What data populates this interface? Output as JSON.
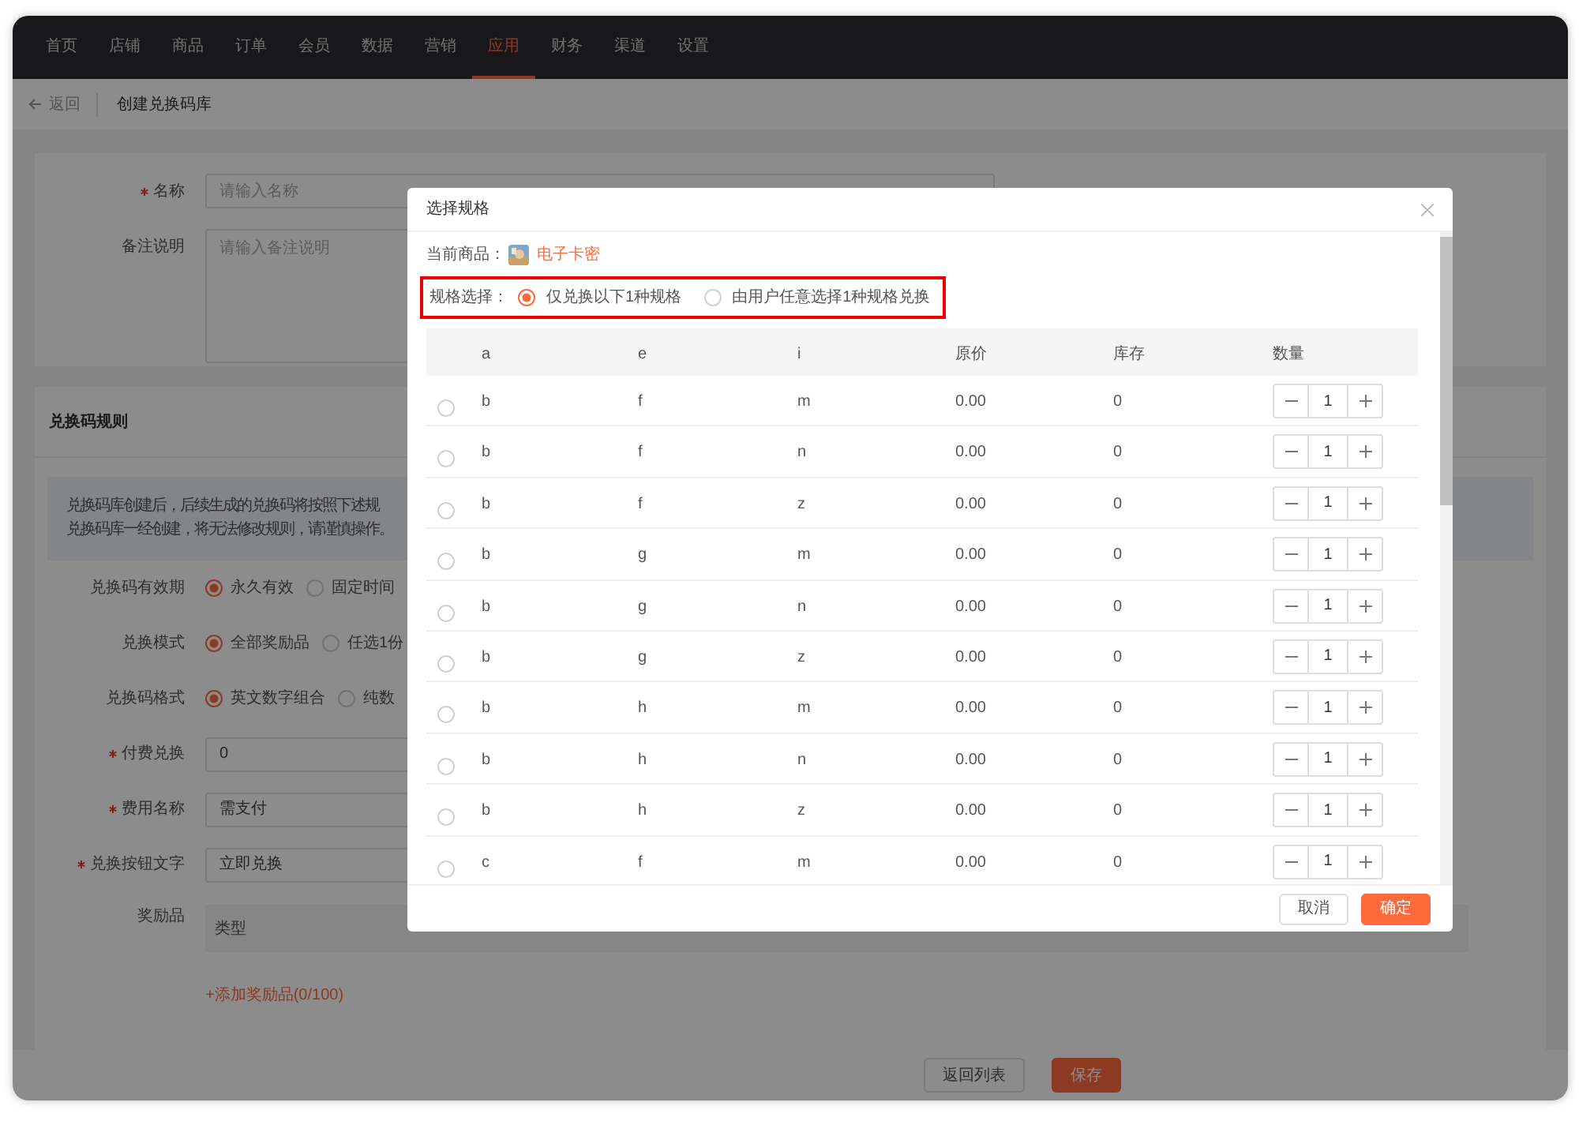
{
  "nav": [
    {
      "label": "首页",
      "selected": false
    },
    {
      "label": "店铺",
      "selected": false
    },
    {
      "label": "商品",
      "selected": false
    },
    {
      "label": "订单",
      "selected": false
    },
    {
      "label": "会员",
      "selected": false
    },
    {
      "label": "数据",
      "selected": false
    },
    {
      "label": "营销",
      "selected": false
    },
    {
      "label": "应用",
      "selected": true
    },
    {
      "label": "财务",
      "selected": false
    },
    {
      "label": "渠道",
      "selected": false
    },
    {
      "label": "设置",
      "selected": false
    }
  ],
  "breadcrumb": {
    "back": "返回",
    "title": "创建兑换码库"
  },
  "basic_form": [
    {
      "label": "名称",
      "required": true,
      "kind": "input",
      "placeholder": "请输入名称"
    },
    {
      "label": "备注说明",
      "required": false,
      "kind": "textarea",
      "placeholder": "请输入备注说明"
    }
  ],
  "rules": {
    "title": "兑换码规则",
    "notice": [
      "兑换码库创建后，后续生成的兑换码将按照下述规",
      "兑换码库一经创建，将无法修改规则，请谨慎操作。"
    ],
    "fields": [
      {
        "label": "兑换码有效期",
        "required": false,
        "kind": "radio",
        "options": [
          {
            "label": "永久有效",
            "selected": true
          },
          {
            "label": "固定时间",
            "selected": false
          }
        ]
      },
      {
        "label": "兑换模式",
        "required": false,
        "kind": "radio",
        "options": [
          {
            "label": "全部奖励品",
            "selected": true
          },
          {
            "label": "任选1份",
            "selected": false
          }
        ]
      },
      {
        "label": "兑换码格式",
        "required": false,
        "kind": "radio",
        "options": [
          {
            "label": "英文数字组合",
            "selected": true
          },
          {
            "label": "纯数",
            "selected": false
          }
        ]
      },
      {
        "label": "付费兑换",
        "required": true,
        "kind": "input",
        "value": "0"
      },
      {
        "label": "费用名称",
        "required": true,
        "kind": "input",
        "value": "需支付"
      },
      {
        "label": "兑换按钮文字",
        "required": true,
        "kind": "input",
        "value": "立即兑换"
      },
      {
        "label": "奖励品",
        "required": false,
        "kind": "table",
        "columns": [
          "类型"
        ]
      }
    ],
    "add_link": "+添加奖励品(0/100)"
  },
  "footer_buttons": [
    {
      "label": "返回列表",
      "kind": "default"
    },
    {
      "label": "保存",
      "kind": "primary"
    }
  ],
  "dialog": {
    "title": "选择规格",
    "product_label": "当前商品：",
    "product_name": "电子卡密",
    "spec_label": "规格选择：",
    "spec_options": [
      {
        "label": "仅兑换以下1种规格",
        "selected": true
      },
      {
        "label": "由用户任意选择1种规格兑换",
        "selected": false
      }
    ],
    "columns": [
      "a",
      "e",
      "i",
      "原价",
      "库存",
      "数量"
    ],
    "rows": [
      {
        "cells": [
          "b",
          "f",
          "m",
          "0.00",
          "0"
        ],
        "quantity": "1",
        "selected": false
      },
      {
        "cells": [
          "b",
          "f",
          "n",
          "0.00",
          "0"
        ],
        "quantity": "1",
        "selected": false
      },
      {
        "cells": [
          "b",
          "f",
          "z",
          "0.00",
          "0"
        ],
        "quantity": "1",
        "selected": false
      },
      {
        "cells": [
          "b",
          "g",
          "m",
          "0.00",
          "0"
        ],
        "quantity": "1",
        "selected": false
      },
      {
        "cells": [
          "b",
          "g",
          "n",
          "0.00",
          "0"
        ],
        "quantity": "1",
        "selected": false
      },
      {
        "cells": [
          "b",
          "g",
          "z",
          "0.00",
          "0"
        ],
        "quantity": "1",
        "selected": false
      },
      {
        "cells": [
          "b",
          "h",
          "m",
          "0.00",
          "0"
        ],
        "quantity": "1",
        "selected": false
      },
      {
        "cells": [
          "b",
          "h",
          "n",
          "0.00",
          "0"
        ],
        "quantity": "1",
        "selected": false
      },
      {
        "cells": [
          "b",
          "h",
          "z",
          "0.00",
          "0"
        ],
        "quantity": "1",
        "selected": false
      },
      {
        "cells": [
          "c",
          "f",
          "m",
          "0.00",
          "0"
        ],
        "quantity": "1",
        "selected": false
      }
    ],
    "buttons": [
      {
        "label": "取消",
        "kind": "default"
      },
      {
        "label": "确定",
        "kind": "primary"
      }
    ]
  }
}
